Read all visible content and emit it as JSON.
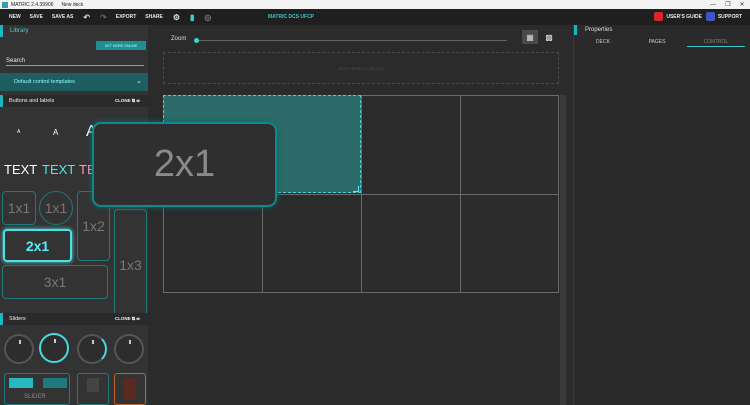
{
  "window": {
    "app_name": "MATRIC 2.4.39906",
    "doc_name": "New deck",
    "minimize": "—",
    "maximize": "❐",
    "close": "✕"
  },
  "menu": {
    "items": [
      "NEW",
      "SAVE",
      "SAVE AS",
      "EXPORT",
      "SHARE"
    ],
    "center_title": "MATRIC DCS UFCP",
    "guide_label": "USER'S GUIDE",
    "support_label": "SUPPORT",
    "undo_icon": "↶",
    "redo_icon": "↷",
    "gear_icon": "⚙",
    "device_icon": "▮",
    "globe_icon": "◎"
  },
  "library": {
    "title": "Library",
    "get_more": "GET MORE ONLINE",
    "search_placeholder": "Search",
    "templates_label": "Default control templates",
    "chev": "⌄",
    "sections": [
      {
        "label": "Buttons and labels",
        "clone": "CLONE ⧉ ⇨"
      },
      {
        "label": "Sliders",
        "clone": "CLONE ⧉ ⇨"
      }
    ],
    "glyphs": [
      "A",
      "A",
      "A"
    ],
    "texts": [
      "TEXT",
      "TEXT",
      "TE"
    ],
    "tiles": [
      "1x1",
      "1x1",
      "1x2",
      "2x1",
      "1x3",
      "3x1"
    ],
    "slider_label": "SLIDER"
  },
  "canvas": {
    "zoom_label": "Zoom",
    "zoom_level": 0,
    "drop_text": "DROP HERE TO DELETE",
    "drag_preview": "2x1",
    "grid_icon": "▦",
    "layout_icon": "▩"
  },
  "properties": {
    "title": "Properties",
    "tabs": [
      "DECK",
      "PAGES",
      "CONTROL"
    ],
    "active_tab": "CONTROL"
  },
  "colors": {
    "accent": "#1bb6bb",
    "support": "#3f55c6",
    "guide": "#d8262b"
  }
}
